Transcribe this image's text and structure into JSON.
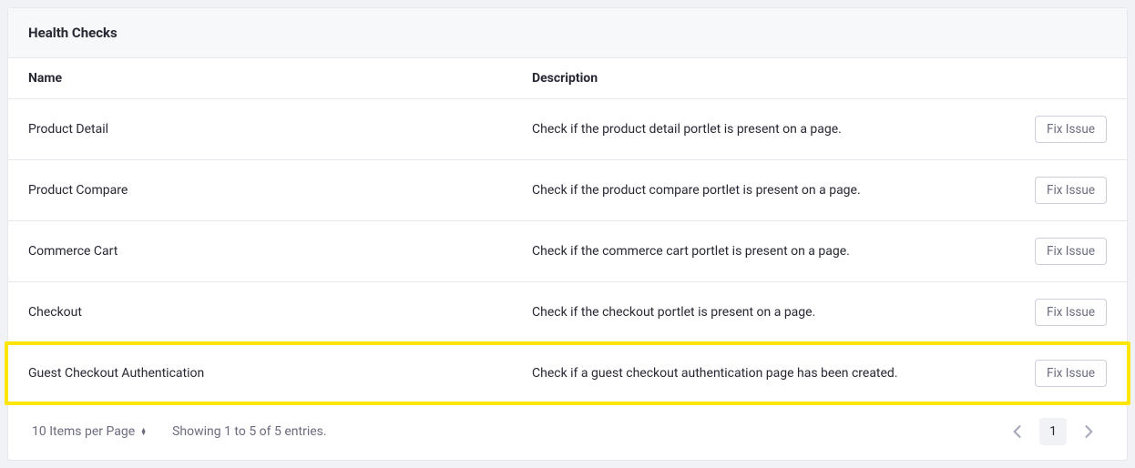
{
  "panel": {
    "title": "Health Checks"
  },
  "columns": {
    "name": "Name",
    "description": "Description"
  },
  "rows": [
    {
      "name": "Product Detail",
      "description": "Check if the product detail portlet is present on a page.",
      "action": "Fix Issue",
      "highlight": false
    },
    {
      "name": "Product Compare",
      "description": "Check if the product compare portlet is present on a page.",
      "action": "Fix Issue",
      "highlight": false
    },
    {
      "name": "Commerce Cart",
      "description": "Check if the commerce cart portlet is present on a page.",
      "action": "Fix Issue",
      "highlight": false
    },
    {
      "name": "Checkout",
      "description": "Check if the checkout portlet is present on a page.",
      "action": "Fix Issue",
      "highlight": false
    },
    {
      "name": "Guest Checkout Authentication",
      "description": "Check if a guest checkout authentication page has been created.",
      "action": "Fix Issue",
      "highlight": true
    }
  ],
  "footer": {
    "items_per_page": "10 Items per Page",
    "entries_info": "Showing 1 to 5 of 5 entries.",
    "current_page": "1"
  }
}
